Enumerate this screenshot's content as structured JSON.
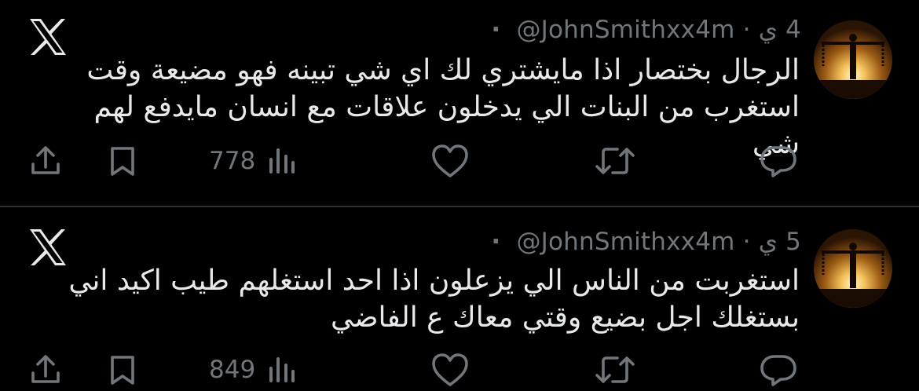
{
  "colors": {
    "background": "#000000",
    "text": "#e7e9ea",
    "muted": "#71767b",
    "divider": "#2f3336"
  },
  "tweets": [
    {
      "dot": "·",
      "handle": "@JohnSmithxx4m",
      "separator": "·",
      "time": "4 ي",
      "text": "الرجال بختصار اذا مايشتري لك اي شي تبينه فهو مضيعة وقت استغرب من البنات الي يدخلون علاقات مع انسان مايدفع لهم شي",
      "views": "778",
      "icons": [
        "share-icon",
        "bookmark-icon",
        "views-icon",
        "like-icon",
        "retweet-icon",
        "reply-icon",
        "x-logo-icon"
      ]
    },
    {
      "dot": "·",
      "handle": "@JohnSmithxx4m",
      "separator": "·",
      "time": "5 ي",
      "text": "استغربت من الناس الي يزعلون اذا احد استغلهم طيب اكيد اني بستغلك اجل بضيع وقتي معاك ع الفاضي",
      "views": "849",
      "icons": [
        "share-icon",
        "bookmark-icon",
        "views-icon",
        "like-icon",
        "retweet-icon",
        "reply-icon",
        "x-logo-icon"
      ]
    }
  ]
}
